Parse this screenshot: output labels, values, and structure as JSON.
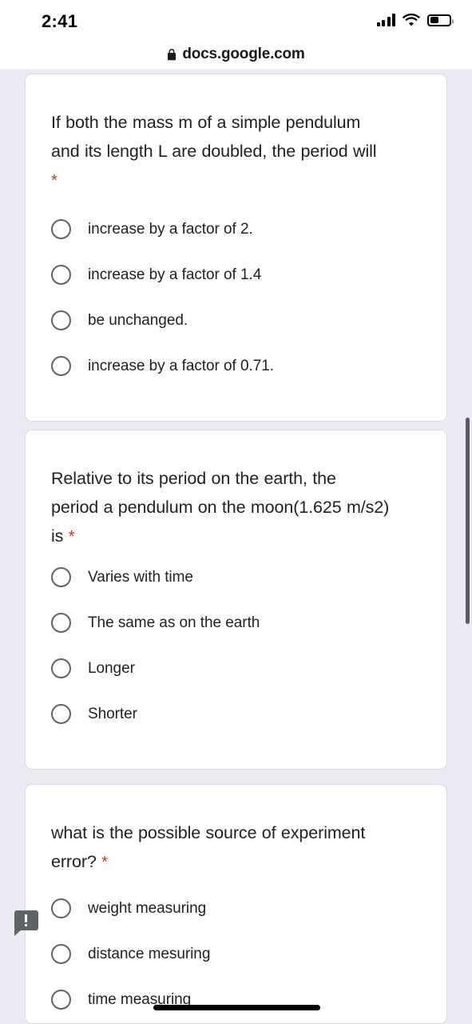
{
  "status_bar": {
    "time": "2:41",
    "signal_icon": "cellular-signal-icon",
    "wifi_icon": "wifi-icon",
    "battery_icon": "battery-icon",
    "battery_level_percent": 40
  },
  "browser": {
    "lock_icon": "lock-icon",
    "url": "docs.google.com"
  },
  "colors": {
    "page_background": "#ecebf4",
    "card_background": "#ffffff",
    "text": "#202124",
    "required_star": "#d93025",
    "radio_border": "#5f6368",
    "scrollbar": "#5c5c62",
    "badge": "#5f6368"
  },
  "form": {
    "questions": [
      {
        "text_line_1": "If both the mass m of a simple pendulum",
        "text_line_2": "and its length L are doubled, the period will",
        "required_star": "*",
        "star_on_own_line": true,
        "options": [
          "increase by a factor of 2.",
          "increase by a factor of 1.4",
          "be unchanged.",
          "increase by a factor of 0.71."
        ]
      },
      {
        "text_line_1": "Relative to its period on the earth, the",
        "text_line_2": "period a pendulum on the moon(1.625 m/s2)",
        "text_line_3": "is",
        "required_star": "*",
        "star_on_own_line": false,
        "options": [
          "Varies with time",
          "The same as on the earth",
          "Longer",
          "Shorter"
        ]
      },
      {
        "text_line_1": "what is the possible source of experiment",
        "text_line_2": "error?",
        "required_star": "*",
        "star_on_own_line": false,
        "options": [
          "weight measuring",
          "distance mesuring",
          "time measuring"
        ]
      }
    ]
  },
  "overlays": {
    "comment_badge_icon": "comment-alert-icon",
    "scrollbar_thumb": "vertical-scrollbar-thumb",
    "home_indicator": "home-indicator-bar"
  }
}
